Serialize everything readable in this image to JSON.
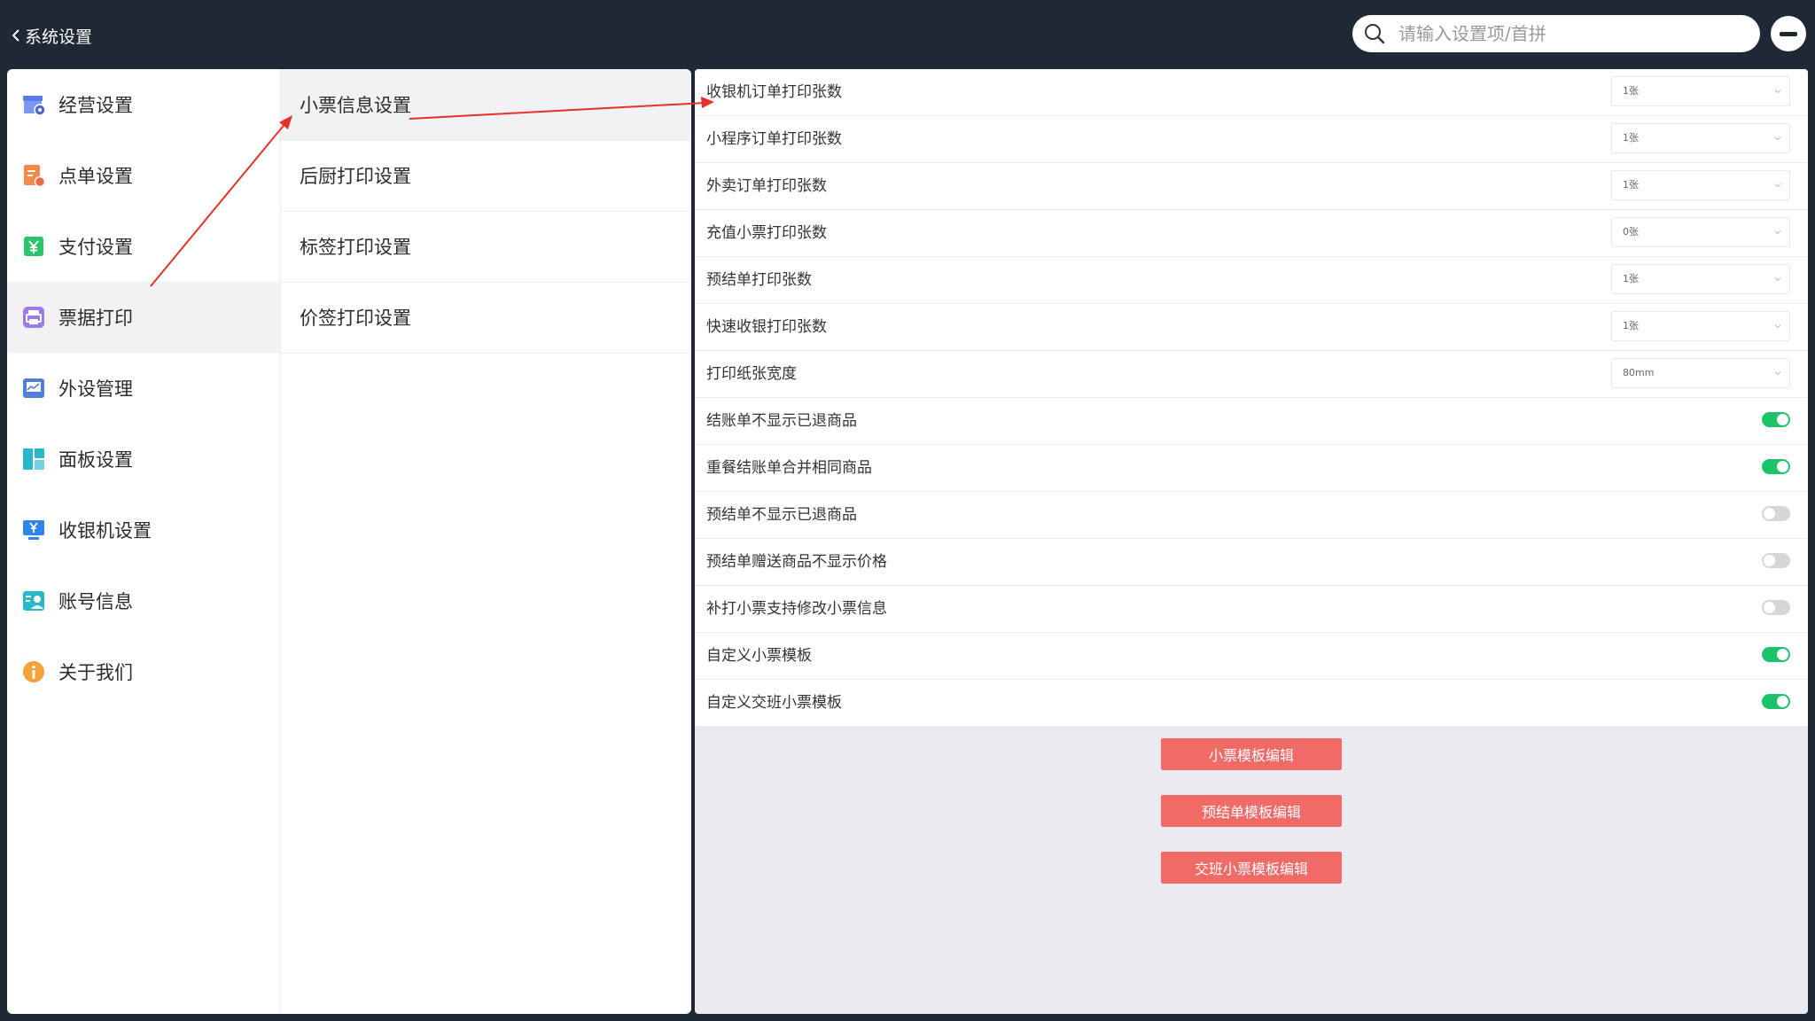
{
  "header": {
    "back_label": "系统设置",
    "search_placeholder": "请输入设置项/首拼"
  },
  "sidebar": {
    "items": [
      {
        "label": "经营设置",
        "icon": "store-settings-icon",
        "color": "#5a7be8"
      },
      {
        "label": "点单设置",
        "icon": "order-list-icon",
        "color": "#f5894a"
      },
      {
        "label": "支付设置",
        "icon": "yuan-payment-icon",
        "color": "#2cc46b"
      },
      {
        "label": "票据打印",
        "icon": "printer-icon",
        "color": "#9b7be8",
        "active": true
      },
      {
        "label": "外设管理",
        "icon": "monitor-device-icon",
        "color": "#4f7fd6"
      },
      {
        "label": "面板设置",
        "icon": "panel-layout-icon",
        "color": "#29b7c9"
      },
      {
        "label": "收银机设置",
        "icon": "cash-register-icon",
        "color": "#2f86e8"
      },
      {
        "label": "账号信息",
        "icon": "account-card-icon",
        "color": "#29b7c9"
      },
      {
        "label": "关于我们",
        "icon": "info-icon",
        "color": "#f5a23a"
      }
    ]
  },
  "subnav": {
    "items": [
      {
        "label": "小票信息设置",
        "active": true
      },
      {
        "label": "后厨打印设置"
      },
      {
        "label": "标签打印设置"
      },
      {
        "label": "价签打印设置"
      }
    ]
  },
  "settings": {
    "selects": [
      {
        "label": "收银机订单打印张数",
        "value": "1张"
      },
      {
        "label": "小程序订单打印张数",
        "value": "1张"
      },
      {
        "label": "外卖订单打印张数",
        "value": "1张"
      },
      {
        "label": "充值小票打印张数",
        "value": "0张"
      },
      {
        "label": "预结单打印张数",
        "value": "1张"
      },
      {
        "label": "快速收银打印张数",
        "value": "1张"
      },
      {
        "label": "打印纸张宽度",
        "value": "80mm"
      }
    ],
    "toggles": [
      {
        "label": "结账单不显示已退商品",
        "on": true
      },
      {
        "label": "重餐结账单合并相同商品",
        "on": true
      },
      {
        "label": "预结单不显示已退商品",
        "on": false
      },
      {
        "label": "预结单赠送商品不显示价格",
        "on": false
      },
      {
        "label": "补打小票支持修改小票信息",
        "on": false
      },
      {
        "label": "自定义小票模板",
        "on": true
      },
      {
        "label": "自定义交班小票模板",
        "on": true
      }
    ]
  },
  "buttons": {
    "receipt_template": "小票模板编辑",
    "prebill_template": "预结单模板编辑",
    "shift_template": "交班小票模板编辑"
  },
  "colors": {
    "header_bg": "#1f2835",
    "toggle_on": "#1dc36b",
    "toggle_off": "#d6d6d6",
    "button_red": "#f06a68",
    "annotation_arrow": "#e8302a"
  }
}
